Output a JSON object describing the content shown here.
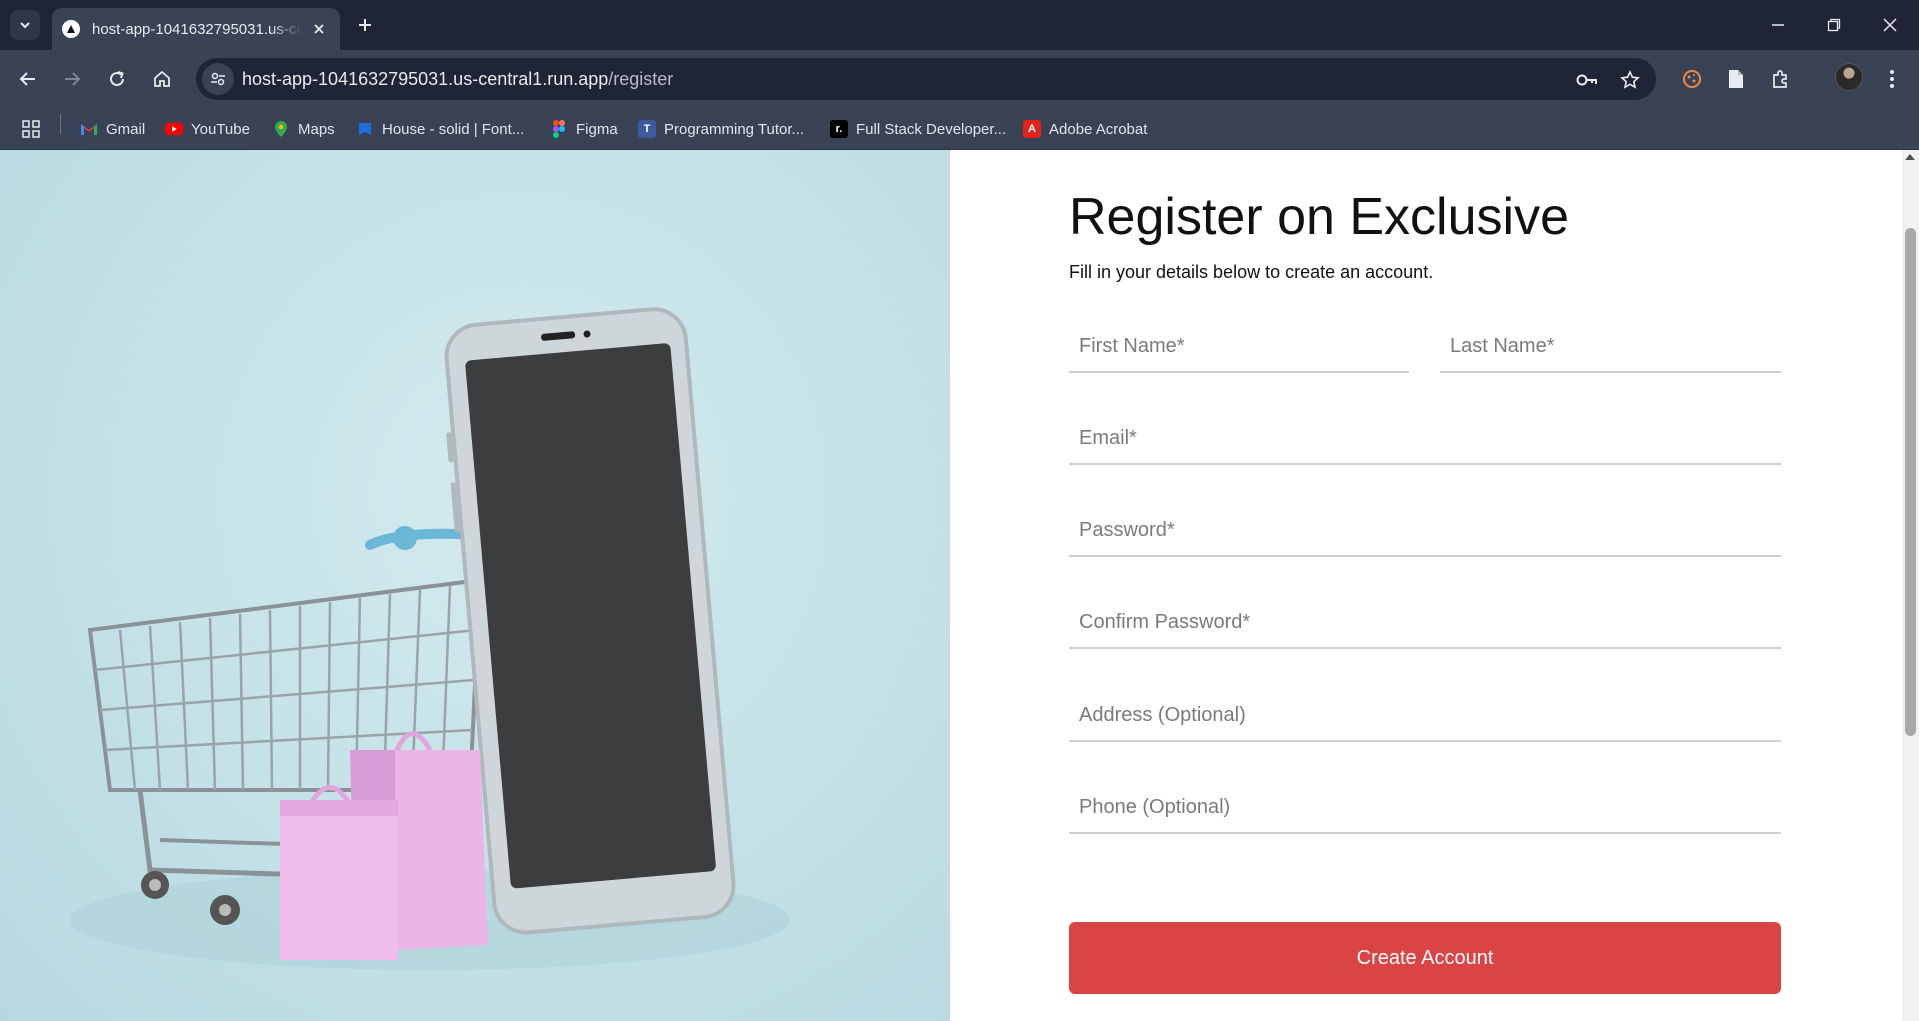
{
  "browser": {
    "tab_title": "host-app-1041632795031.us-central1.run.app",
    "url_host": "host-app-1041632795031.us-central1.run.app",
    "url_path": "/register",
    "bookmarks": [
      {
        "label": "Gmail",
        "icon": "gmail-icon",
        "color": "#ea4335"
      },
      {
        "label": "YouTube",
        "icon": "youtube-icon",
        "color": "#ff0000"
      },
      {
        "label": "Maps",
        "icon": "maps-icon",
        "color": "#34a853"
      },
      {
        "label": "House - solid | Font...",
        "icon": "fontawesome-icon",
        "color": "#1e6fd9"
      },
      {
        "label": "Figma",
        "icon": "figma-icon",
        "color": "#a259ff"
      },
      {
        "label": "Programming Tutor...",
        "icon": "programming-icon",
        "color": "#3d5a9e"
      },
      {
        "label": "Full Stack Developer...",
        "icon": "fullstack-icon",
        "color": "#000000"
      },
      {
        "label": "Adobe Acrobat",
        "icon": "acrobat-icon",
        "color": "#e0241b"
      }
    ]
  },
  "register": {
    "title": "Register on Exclusive",
    "subtitle": "Fill in your details below to create an account.",
    "fields": {
      "first_name": "First Name*",
      "last_name": "Last Name*",
      "email": "Email*",
      "password": "Password*",
      "confirm_password": "Confirm Password*",
      "address": "Address (Optional)",
      "phone": "Phone (Optional)"
    },
    "submit_label": "Create Account",
    "accent_color": "#db4444"
  },
  "hero": {
    "image": "phone-and-shopping-cart-illustration"
  }
}
